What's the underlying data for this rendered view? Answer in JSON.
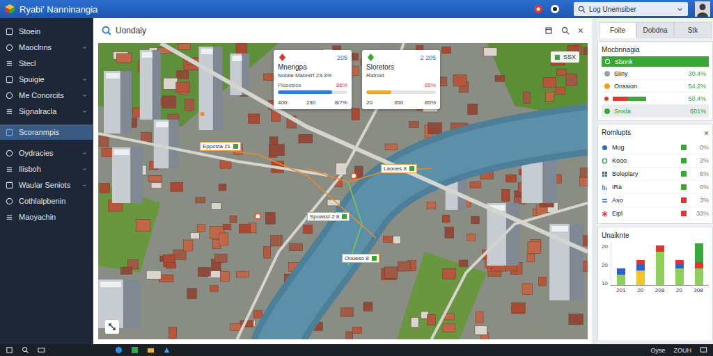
{
  "window": {
    "title": "Ryabi' Nanninangia"
  },
  "top_bar": {
    "search": "Log Unemsiber"
  },
  "sidebar": {
    "items": [
      {
        "label": "Stoein",
        "expandable": false,
        "selected": false
      },
      {
        "label": "Maoclnns",
        "expandable": true,
        "selected": false
      },
      {
        "label": "Stecl",
        "expandable": false,
        "selected": false
      },
      {
        "label": "Spuigie",
        "expandable": true,
        "selected": false
      },
      {
        "label": "Me Conorcits",
        "expandable": true,
        "selected": false
      },
      {
        "label": "Signalracla",
        "expandable": true,
        "selected": false
      },
      {
        "label": "Scoranmpis",
        "expandable": false,
        "selected": true
      },
      {
        "label": "Oydracies",
        "expandable": true,
        "selected": false
      },
      {
        "label": "Ilisboh",
        "expandable": true,
        "selected": false
      },
      {
        "label": "Waular Seniots",
        "expandable": true,
        "selected": false
      },
      {
        "label": "Cothlalpbenin",
        "expandable": false,
        "selected": false
      },
      {
        "label": "Maoyachin",
        "expandable": false,
        "selected": false
      }
    ]
  },
  "map_panel": {
    "title": "Uondaiy",
    "close": "×",
    "badge": "SSX",
    "cards": [
      {
        "title": "Mnengpa",
        "code": "205",
        "subtitle": "Nobile Mabrerf 23.3%",
        "label": "Picessios",
        "value": "86%",
        "level": 0.78,
        "color": "#2f7fd6",
        "footer": [
          "400",
          "230",
          "8/7%"
        ]
      },
      {
        "title": "Sloretors",
        "code": "2 205",
        "subtitle": "Ratnod",
        "label": "",
        "value": "65%",
        "level": 0.36,
        "color": "#f0a830",
        "footer": [
          "20",
          "350",
          "85%"
        ]
      }
    ],
    "tags": [
      {
        "label": "Eppcsta 21"
      },
      {
        "label": "Laooes 8"
      },
      {
        "label": "Spoasst 2 8"
      },
      {
        "label": "Ooueso 8"
      }
    ]
  },
  "right_panel": {
    "tabs": [
      {
        "label": "Foite",
        "selected": true
      },
      {
        "label": "Dobdna",
        "selected": false
      },
      {
        "label": "Stk",
        "selected": false
      }
    ],
    "layers": {
      "title": "Mocbnnagia",
      "items": [
        {
          "kind": "highlight",
          "label": "Sbnnk",
          "value": "",
          "selected": true,
          "level": 0,
          "color": "#3aa635"
        },
        {
          "kind": "stat",
          "label": "Siiny",
          "value": "30.4%",
          "selected": false,
          "level": 0,
          "color": "#9aa3ad"
        },
        {
          "kind": "stat",
          "label": "Onssion",
          "value": "54.2%",
          "selected": false,
          "level": 0,
          "color": "#f0a020"
        },
        {
          "kind": "meter",
          "label": "",
          "value": "50.4%",
          "selected": false,
          "level": 0.45,
          "color": "#e03a2f"
        },
        {
          "kind": "summary",
          "label": "Sroda",
          "value": "601%",
          "selected": false,
          "level": 0,
          "color": "#3aa635"
        }
      ]
    },
    "results": {
      "title": "Romlupts",
      "close": "×",
      "items": [
        {
          "label": "Mug",
          "value": "0%",
          "color": "#3aa635"
        },
        {
          "label": "Kooo",
          "value": "3%",
          "color": "#3aa635"
        },
        {
          "label": "Boleplary",
          "value": "6%",
          "color": "#3aa635"
        },
        {
          "label": "IRa",
          "value": "0%",
          "color": "#3aa635"
        },
        {
          "label": "Aso",
          "value": "3%",
          "color": "#d9343a"
        },
        {
          "label": "Eipl",
          "value": "33%",
          "color": "#d9343a"
        }
      ]
    },
    "chart": {
      "title": "Unaiknte",
      "y_ticks": [
        "20",
        "20",
        "10"
      ],
      "x_labels": [
        "201",
        "20",
        "208",
        "20",
        "308"
      ],
      "series": [
        {
          "color": "#8fd05a",
          "values": [
            5,
            0,
            16,
            8,
            8
          ]
        },
        {
          "color": "#f2c531",
          "values": [
            0,
            7,
            0,
            0,
            0
          ]
        },
        {
          "color": "#2f5fc4",
          "values": [
            3,
            3,
            0,
            2,
            0
          ]
        },
        {
          "color": "#e2342f",
          "values": [
            0,
            2,
            3,
            2,
            3
          ]
        },
        {
          "color": "#36a83c",
          "values": [
            0,
            0,
            0,
            0,
            9
          ]
        }
      ]
    }
  },
  "taskbar": {
    "items": [
      "Oyse",
      "ZOUH"
    ]
  }
}
